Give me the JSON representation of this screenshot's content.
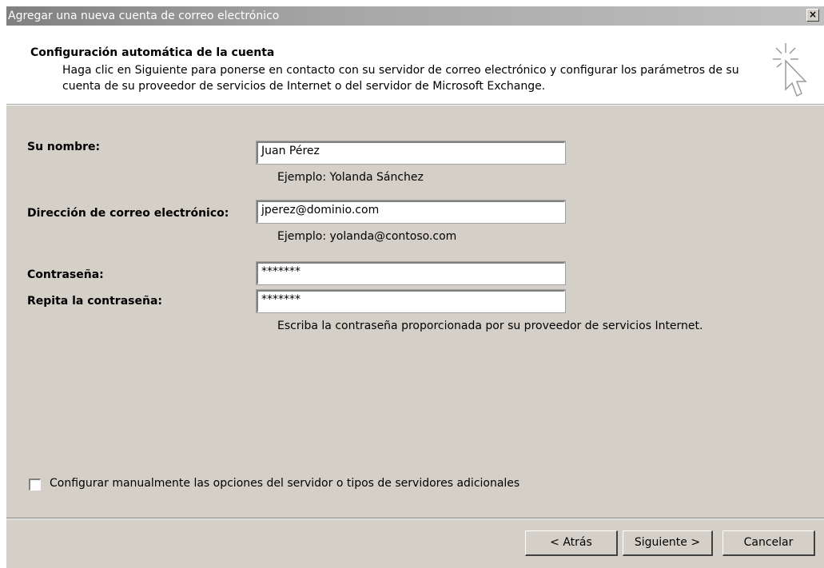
{
  "window": {
    "title": "Agregar una nueva cuenta de correo electrónico",
    "close_label": "×"
  },
  "header": {
    "title": "Configuración automática de la cuenta",
    "description": "Haga clic en Siguiente para ponerse en contacto con su servidor de correo electrónico y configurar los parámetros de su cuenta de su proveedor de servicios de Internet o del servidor de Microsoft Exchange.",
    "icon": "cursor-sparkle-icon"
  },
  "form": {
    "name_label": "Su nombre:",
    "name_value": "Juan Pérez",
    "name_hint": "Ejemplo: Yolanda Sánchez",
    "email_label": "Dirección de correo electrónico:",
    "email_value": "jperez@dominio.com",
    "email_hint": "Ejemplo: yolanda@contoso.com",
    "password_label": "Contraseña:",
    "password_value": "*******",
    "repeat_label": "Repita la contraseña:",
    "repeat_value": "*******",
    "password_hint": "Escriba la contraseña proporcionada por su proveedor de servicios Internet."
  },
  "manual": {
    "label": "Configurar manualmente las opciones del servidor o tipos de servidores adicionales",
    "checked": false
  },
  "buttons": {
    "back": "< Atrás",
    "next": "Siguiente >",
    "cancel": "Cancelar"
  }
}
